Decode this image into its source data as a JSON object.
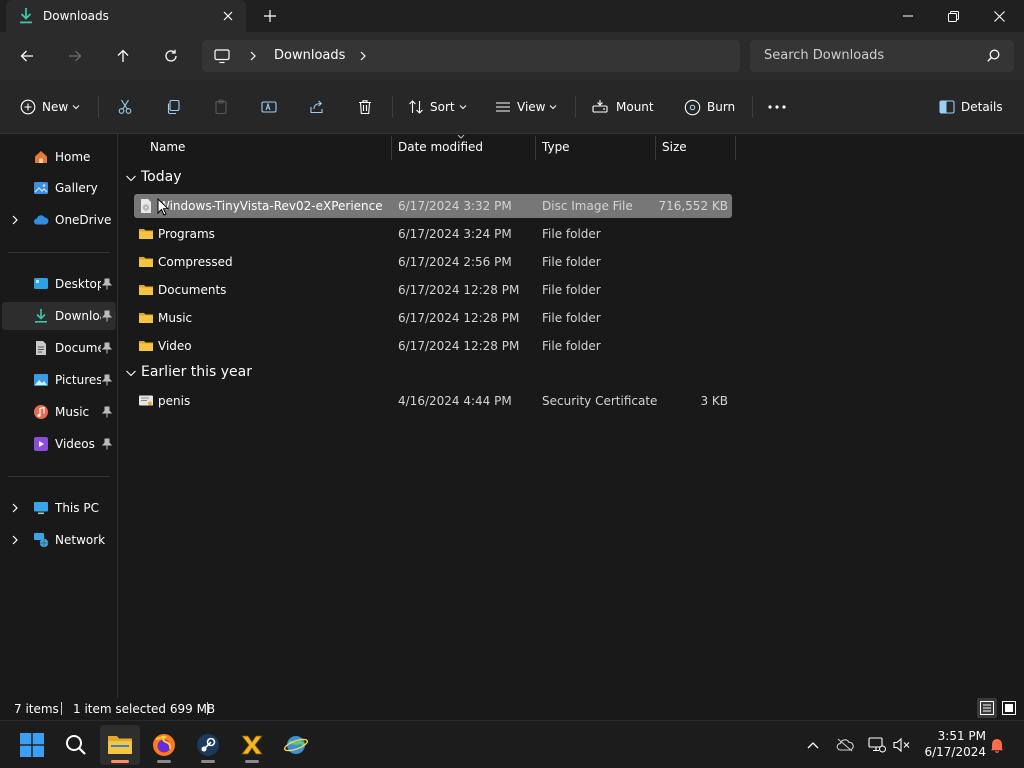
{
  "window": {
    "tab_label": "Downloads",
    "colors": {
      "accent": "#ff8b5f",
      "folder": "#f5c542",
      "selected_row": "#777777",
      "background": "#191919"
    }
  },
  "address": {
    "crumb": "Downloads",
    "search_placeholder": "Search Downloads"
  },
  "commandbar": {
    "new_label": "New",
    "sort_label": "Sort",
    "view_label": "View",
    "mount_label": "Mount",
    "burn_label": "Burn",
    "details_label": "Details"
  },
  "sidebar": {
    "items": [
      {
        "label": "Home",
        "icon": "home-icon"
      },
      {
        "label": "Gallery",
        "icon": "gallery-icon"
      },
      {
        "label": "OneDrive",
        "icon": "cloud-icon"
      },
      {
        "label": "Desktop",
        "icon": "desktop-icon"
      },
      {
        "label": "Downloads",
        "icon": "download-icon"
      },
      {
        "label": "Documents",
        "icon": "document-icon"
      },
      {
        "label": "Pictures",
        "icon": "picture-icon"
      },
      {
        "label": "Music",
        "icon": "music-icon"
      },
      {
        "label": "Videos",
        "icon": "video-icon"
      },
      {
        "label": "This PC",
        "icon": "pc-icon"
      },
      {
        "label": "Network",
        "icon": "network-icon"
      }
    ]
  },
  "filelist": {
    "columns": [
      "Name",
      "Date modified",
      "Type",
      "Size"
    ],
    "groups": [
      {
        "label": "Today",
        "rows": [
          {
            "name": "Windows-TinyVista-Rev02-eXPerience",
            "date": "6/17/2024 3:32 PM",
            "type": "Disc Image File",
            "size": "716,552 KB",
            "icon": "disc-image-icon"
          },
          {
            "name": "Programs",
            "date": "6/17/2024 3:24 PM",
            "type": "File folder",
            "size": "",
            "icon": "folder-icon"
          },
          {
            "name": "Compressed",
            "date": "6/17/2024 2:56 PM",
            "type": "File folder",
            "size": "",
            "icon": "folder-icon"
          },
          {
            "name": "Documents",
            "date": "6/17/2024 12:28 PM",
            "type": "File folder",
            "size": "",
            "icon": "folder-icon"
          },
          {
            "name": "Music",
            "date": "6/17/2024 12:28 PM",
            "type": "File folder",
            "size": "",
            "icon": "folder-icon"
          },
          {
            "name": "Video",
            "date": "6/17/2024 12:28 PM",
            "type": "File folder",
            "size": "",
            "icon": "folder-icon"
          }
        ]
      },
      {
        "label": "Earlier this year",
        "rows": [
          {
            "name": "penis",
            "date": "4/16/2024 4:44 PM",
            "type": "Security Certificate",
            "size": "3 KB",
            "icon": "certificate-icon"
          }
        ]
      }
    ]
  },
  "status": {
    "items_count": "7 items",
    "selection": "1 item selected  699 MB"
  },
  "taskbar": {
    "time": "3:51 PM",
    "date": "6/17/2024"
  }
}
